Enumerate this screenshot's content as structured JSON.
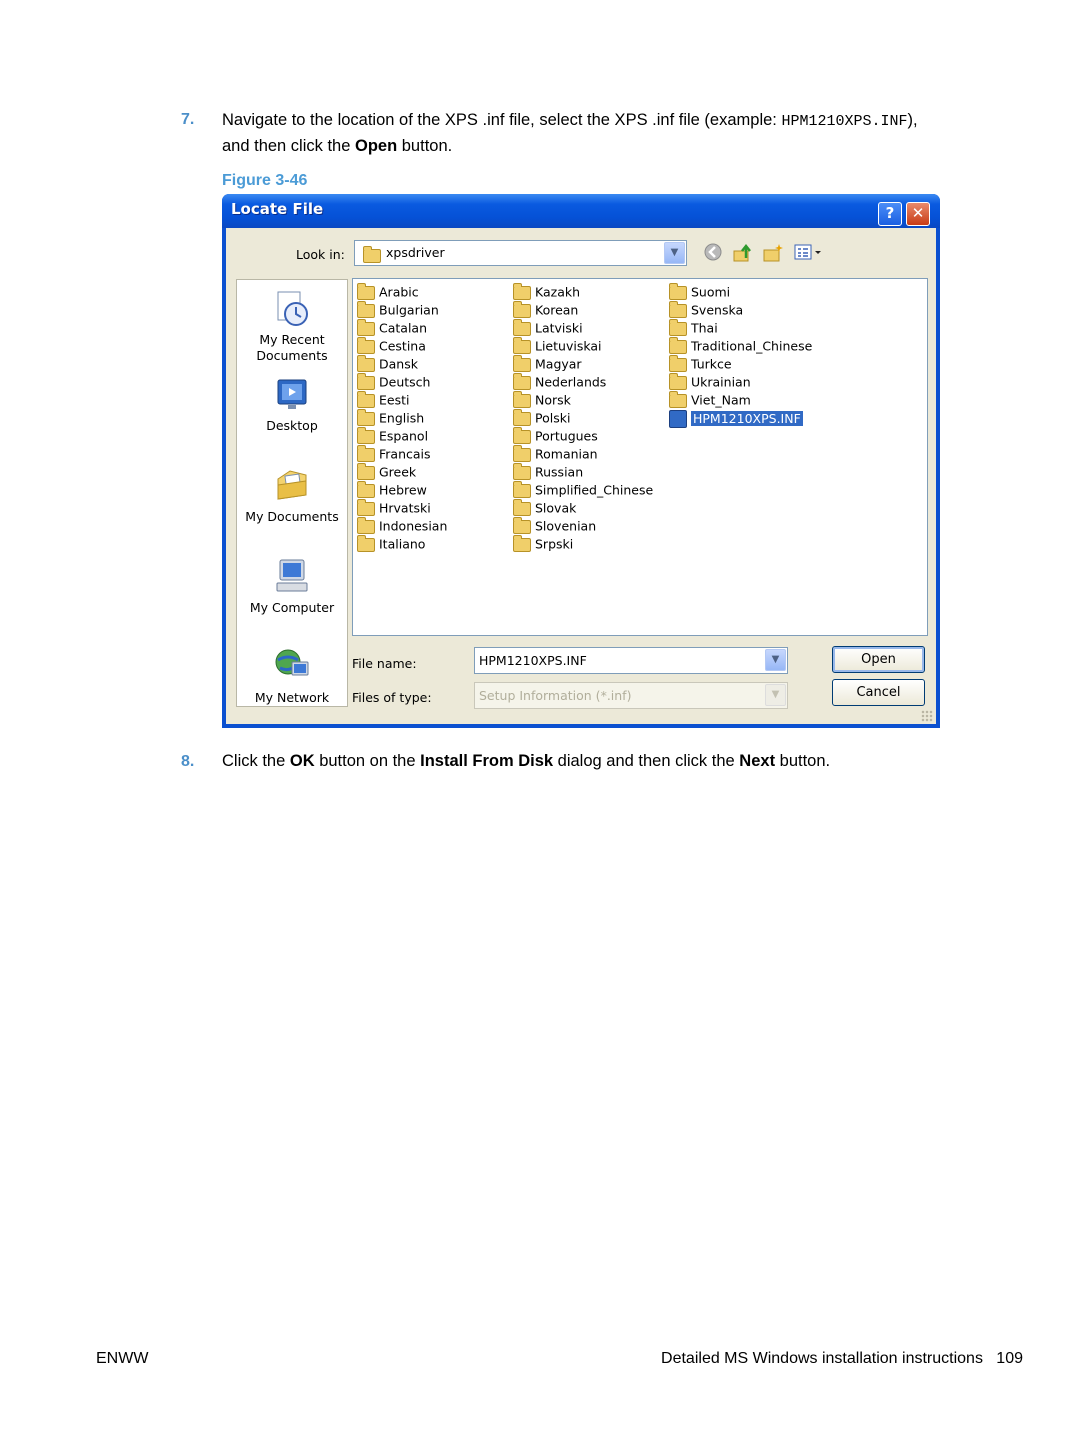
{
  "step7": {
    "number": "7.",
    "text_a": "Navigate to the location of the XPS .inf file, select the XPS .inf file (example: ",
    "code": "HPM1210XPS.INF",
    "text_b": "),",
    "text_c": "and then click the ",
    "bold": "Open",
    "text_d": " button."
  },
  "figure_caption": "Figure 3-46",
  "dialog": {
    "title": "Locate File",
    "help_glyph": "?",
    "close_glyph": "✕",
    "look_in_label": "Look in:",
    "look_in_value": "xpsdriver",
    "combo_arrow": "▼",
    "toolbar_icons": [
      "back-icon",
      "up-folder-icon",
      "new-folder-icon",
      "views-menu-icon"
    ],
    "places": [
      "My Recent\nDocuments",
      "Desktop",
      "My Documents",
      "My Computer",
      "My Network"
    ],
    "columns": [
      [
        "Arabic",
        "Bulgarian",
        "Catalan",
        "Cestina",
        "Dansk",
        "Deutsch",
        "Eesti",
        "English",
        "Espanol",
        "Francais",
        "Greek",
        "Hebrew",
        "Hrvatski",
        "Indonesian",
        "Italiano"
      ],
      [
        "Kazakh",
        "Korean",
        "Latviski",
        "Lietuviskai",
        "Magyar",
        "Nederlands",
        "Norsk",
        "Polski",
        "Portugues",
        "Romanian",
        "Russian",
        "Simplified_Chinese",
        "Slovak",
        "Slovenian",
        "Srpski"
      ],
      [
        "Suomi",
        "Svenska",
        "Thai",
        "Traditional_Chinese",
        "Turkce",
        "Ukrainian",
        "Viet_Nam"
      ]
    ],
    "selected_file": "HPM1210XPS.INF",
    "file_name_label": "File name:",
    "file_name_value": "HPM1210XPS.INF",
    "files_of_type_label": "Files of type:",
    "files_of_type_value": "Setup Information (*.inf)",
    "open_button": "Open",
    "cancel_button": "Cancel",
    "accent_color": "#0b50d0",
    "selection_color": "#316ac5"
  },
  "step8": {
    "number": "8.",
    "t1": "Click the ",
    "b1": "OK",
    "t2": " button on the ",
    "b2": "Install From Disk",
    "t3": " dialog and then click the ",
    "b3": "Next",
    "t4": " button."
  },
  "footer": {
    "left": "ENWW",
    "title": "Detailed MS Windows installation instructions",
    "page": "109"
  }
}
